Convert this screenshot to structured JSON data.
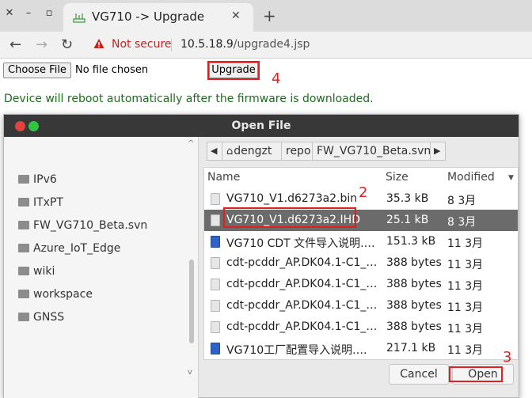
{
  "browser": {
    "window_controls": {
      "close": "✕",
      "minimize": "–",
      "maximize": "▫"
    },
    "tab": {
      "title": "VG710 -> Upgrade",
      "close": "✕"
    },
    "new_tab": "+",
    "nav": {
      "back": "←",
      "forward": "→",
      "reload": "↻"
    },
    "address": {
      "security": "Not secure",
      "host": "10.5.18.9",
      "path": "/upgrade4.jsp"
    }
  },
  "page": {
    "choose_file_label": "Choose File",
    "file_status": "No file chosen",
    "upgrade_label": "Upgrade",
    "reboot_message": "Device will reboot automatically after the firmware is downloaded.",
    "message_color": "#1e6b1e"
  },
  "annotations": {
    "step_4": "4",
    "step_2": "2",
    "step_3": "3",
    "color": "#e02020"
  },
  "dialog": {
    "title": "Open File",
    "places": [
      "IPv6",
      "ITxPT",
      "FW_VG710_Beta.svn",
      "Azure_IoT_Edge",
      "wiki",
      "workspace",
      "GNSS"
    ],
    "breadcrumb": {
      "back": "◀",
      "home": "dengzt",
      "items": [
        "repo",
        "FW_VG710_Beta.svn"
      ],
      "forward": "▶"
    },
    "columns": {
      "name": "Name",
      "size": "Size",
      "modified": "Modified"
    },
    "files": [
      {
        "name": "VG710_V1.d6273a2.bin",
        "size": "35.3 kB",
        "modified": "8 3月",
        "icon": "generic-file-icon"
      },
      {
        "name": "VG710_V1.d6273a2.IHD",
        "size": "25.1 kB",
        "modified": "8 3月",
        "icon": "generic-file-icon"
      },
      {
        "name": "VG710 CDT 文件导入说明.…",
        "size": "151.3 kB",
        "modified": "11 3月",
        "icon": "document-icon"
      },
      {
        "name": "cdt-pcddr_AP.DK04.1-C1_…",
        "size": "388 bytes",
        "modified": "11 3月",
        "icon": "generic-file-icon"
      },
      {
        "name": "cdt-pcddr_AP.DK04.1-C1_…",
        "size": "388 bytes",
        "modified": "11 3月",
        "icon": "generic-file-icon"
      },
      {
        "name": "cdt-pcddr_AP.DK04.1-C1_…",
        "size": "388 bytes",
        "modified": "11 3月",
        "icon": "generic-file-icon"
      },
      {
        "name": "cdt-pcddr_AP.DK04.1-C1_…",
        "size": "388 bytes",
        "modified": "11 3月",
        "icon": "generic-file-icon"
      },
      {
        "name": "VG710工厂配置导入说明.…",
        "size": "217.1 kB",
        "modified": "11 3月",
        "icon": "document-icon"
      }
    ],
    "selected_file": "VG710_V1.d6273a2.IHD",
    "cancel_label": "Cancel",
    "open_label": "Open"
  }
}
